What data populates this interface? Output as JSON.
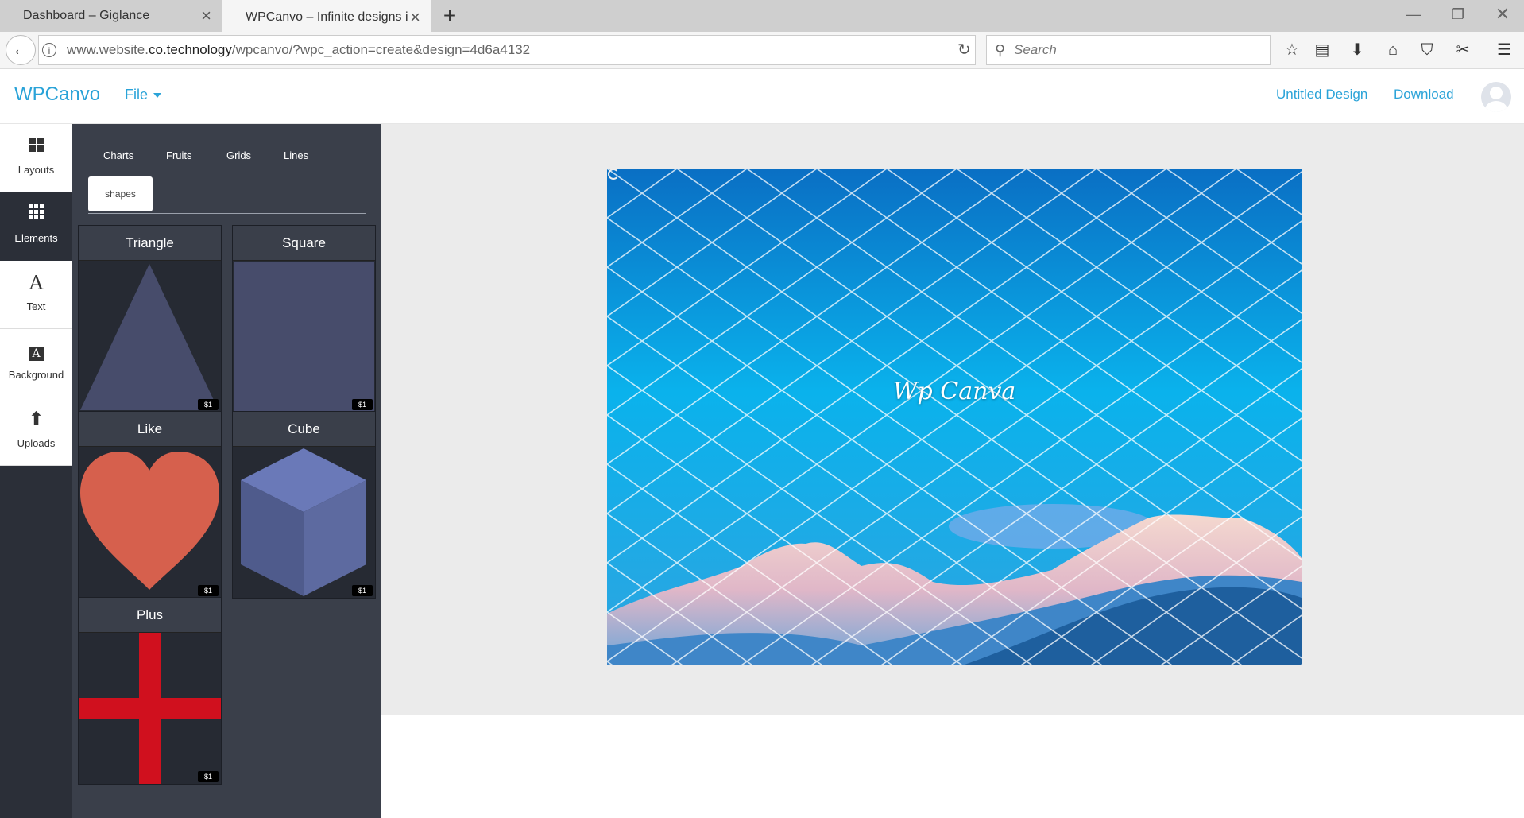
{
  "browser": {
    "tabs": [
      {
        "title": "Dashboard – Giglance",
        "active": false
      },
      {
        "title": "WPCanvo – Infinite designs in m",
        "active": true
      }
    ],
    "new_tab": "+",
    "url_prefix": "www.website.",
    "url_domain": "co.technology",
    "url_path": "/wpcanvo/?wpc_action=create&design=4d6a4132",
    "search_placeholder": "Search"
  },
  "app": {
    "brand": "WPCanvo",
    "file_menu": "File",
    "design_name": "Untitled Design",
    "download": "Download",
    "accent_color": "#2aa3d8"
  },
  "sidenav": {
    "items": [
      {
        "label": "Layouts",
        "icon": "layouts-icon",
        "active": false
      },
      {
        "label": "Elements",
        "icon": "elements-icon",
        "active": true
      },
      {
        "label": "Text",
        "icon": "text-icon",
        "active": false
      },
      {
        "label": "Background",
        "icon": "background-icon",
        "active": false
      },
      {
        "label": "Uploads",
        "icon": "upload-icon",
        "active": false
      }
    ]
  },
  "elements_panel": {
    "categories": [
      "Charts",
      "Fruits",
      "Grids",
      "Lines"
    ],
    "active_category": "shapes",
    "items": [
      {
        "title": "Triangle",
        "price": "$1",
        "color": "#474c6b"
      },
      {
        "title": "Square",
        "price": "$1",
        "color": "#474c6b"
      },
      {
        "title": "Like",
        "price": "$1",
        "color": "#d6604d"
      },
      {
        "title": "Cube",
        "price": "$1",
        "color": "#6a79b8"
      },
      {
        "title": "Plus",
        "price": "$1",
        "color": "#d0101e"
      }
    ]
  },
  "canvas": {
    "text": "Wp Canva"
  }
}
